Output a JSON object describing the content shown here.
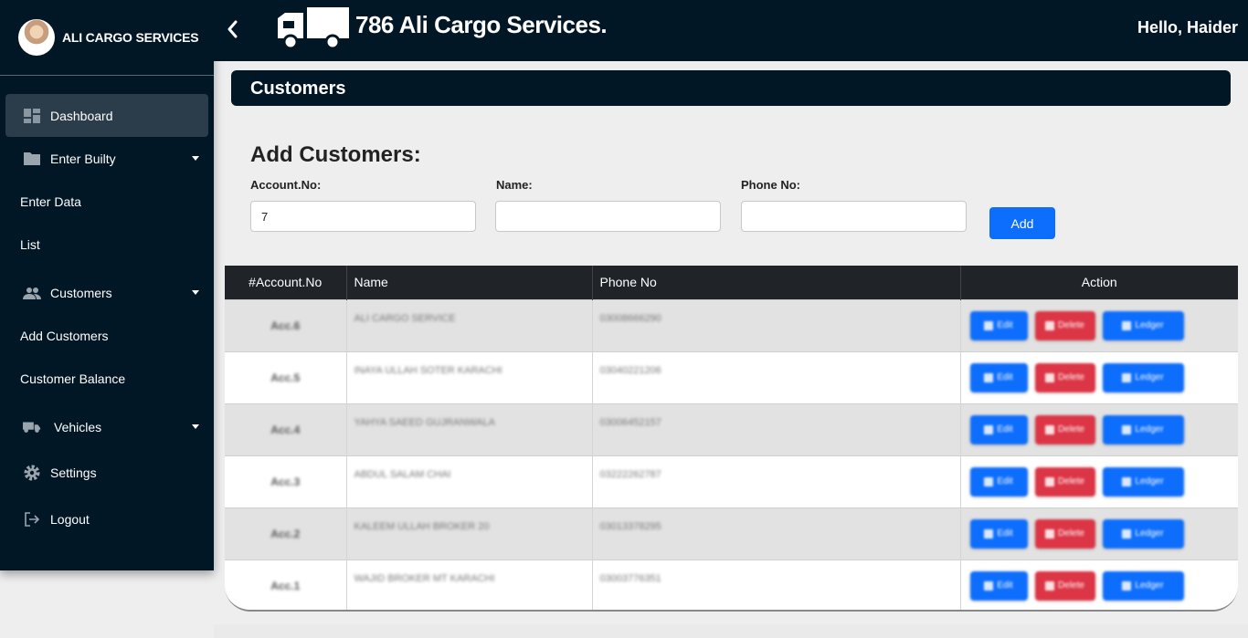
{
  "brand": {
    "name": "ALI CARGO SERVICES",
    "logo": "avatar-logo"
  },
  "sidebar": {
    "items": [
      {
        "label": "Dashboard",
        "icon": "dashboard-icon",
        "active": true
      },
      {
        "label": "Enter Builty",
        "icon": "folder-icon",
        "dropdown": true
      },
      {
        "label": "Enter Data"
      },
      {
        "label": "List"
      },
      {
        "label": "Customers",
        "icon": "people-icon",
        "dropdown": true
      },
      {
        "label": "Add Customers"
      },
      {
        "label": "Customer Balance"
      },
      {
        "label": "Vehicles",
        "icon": "truck-icon",
        "dropdown": true
      },
      {
        "label": "Settings",
        "icon": "gear-icon"
      },
      {
        "label": "Logout",
        "icon": "logout-icon"
      }
    ]
  },
  "topbar": {
    "title": "786 Ali Cargo Services.",
    "greeting": "Hello, Haider",
    "back_icon": "chevron-left-icon",
    "logo_icon": "truck-icon"
  },
  "page": {
    "header": "Customers"
  },
  "form": {
    "title": "Add Customers:",
    "account_label": "Account.No:",
    "account_value": "7",
    "name_label": "Name:",
    "name_value": "",
    "phone_label": "Phone No:",
    "phone_value": "",
    "add_label": "Add"
  },
  "table": {
    "headers": [
      "#Account.No",
      "Name",
      "Phone No",
      "Action"
    ],
    "rows": [
      {
        "acct": "Acc.6",
        "name": "ALI CARGO SERVICE",
        "phone": "03008666290"
      },
      {
        "acct": "Acc.5",
        "name": "INAYA ULLAH SOTER KARACHI",
        "phone": "03040221206"
      },
      {
        "acct": "Acc.4",
        "name": "YAHYA SAEED GUJRANWALA",
        "phone": "03006452157"
      },
      {
        "acct": "Acc.3",
        "name": "ABDUL SALAM CHAI",
        "phone": "03222262787"
      },
      {
        "acct": "Acc.2",
        "name": "KALEEM ULLAH BROKER 20",
        "phone": "03013378295"
      },
      {
        "acct": "Acc.1",
        "name": "WAJID BROKER MT KARACHI",
        "phone": "03003776351"
      }
    ],
    "actions": {
      "edit": "Edit",
      "delete": "Delete",
      "ledger": "Ledger"
    }
  },
  "colors": {
    "navy": "#021725",
    "primary": "#0d6efd",
    "danger": "#dc3545",
    "table_header": "#202328"
  }
}
